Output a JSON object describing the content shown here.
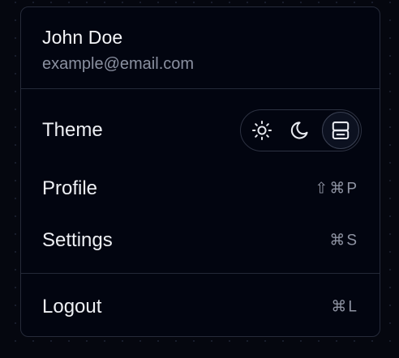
{
  "user": {
    "name": "John Doe",
    "email": "example@email.com"
  },
  "theme": {
    "label": "Theme",
    "options": [
      {
        "icon": "sun-icon"
      },
      {
        "icon": "moon-icon"
      },
      {
        "icon": "system-icon",
        "selected": true
      }
    ]
  },
  "items": {
    "profile": {
      "label": "Profile",
      "shortcut": "⇧⌘P"
    },
    "settings": {
      "label": "Settings",
      "shortcut": "⌘S"
    },
    "logout": {
      "label": "Logout",
      "shortcut": "⌘L"
    }
  },
  "colors": {
    "background": "#05070f",
    "panel": "#020510",
    "border": "#262b3a",
    "text": "#eef0f4",
    "muted": "#8a90a0"
  }
}
